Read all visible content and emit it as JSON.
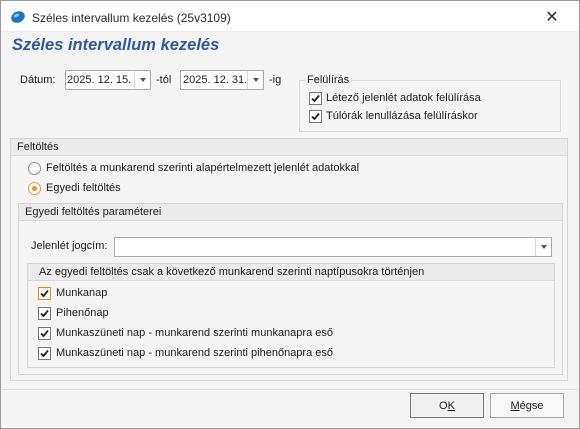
{
  "window": {
    "title": "Széles intervallum kezelés (25v3109)",
    "close_glyph": "✕"
  },
  "heading": "Széles intervallum kezelés",
  "dates": {
    "label": "Dátum:",
    "from_value": "2025. 12. 15.",
    "from_suffix": "-tól",
    "to_value": "2025. 12. 31.",
    "to_suffix": "-ig"
  },
  "overwrite": {
    "title": "Felülírás",
    "options": [
      {
        "label": "Létező jelenlét adatok felülírása",
        "checked": true
      },
      {
        "label": "Túlórák lenullázása felülíráskor",
        "checked": true
      }
    ]
  },
  "filling": {
    "title": "Feltöltés",
    "options": [
      {
        "label": "Feltöltés a munkarend szerinti alapértelmezett jelenlét adatokkal",
        "selected": false
      },
      {
        "label": "Egyedi feltöltés",
        "selected": true
      }
    ]
  },
  "custom": {
    "title": "Egyedi feltöltés paraméterei",
    "presence_label": "Jelenlét jogcím:",
    "presence_value": "",
    "daytypes": {
      "title": "Az egyedi feltöltés csak a következő munkarend szerinti naptípusokra történjen",
      "items": [
        {
          "label": "Munkanap",
          "checked": true
        },
        {
          "label": "Pihenőnap",
          "checked": true
        },
        {
          "label": "Munkaszüneti nap - munkarend szerinti munkanapra eső",
          "checked": true
        },
        {
          "label": "Munkaszüneti nap - munkarend szerinti pihenőnapra eső",
          "checked": true
        }
      ]
    }
  },
  "buttons": {
    "ok_prefix": "O",
    "ok_mnemonic": "K",
    "cancel_prefix": "",
    "cancel_mnemonic": "M",
    "cancel_rest": "égse"
  },
  "colors": {
    "heading": "#2d5aa2",
    "accent_orange": "#e0962a",
    "app_icon": "#1e73c9"
  }
}
